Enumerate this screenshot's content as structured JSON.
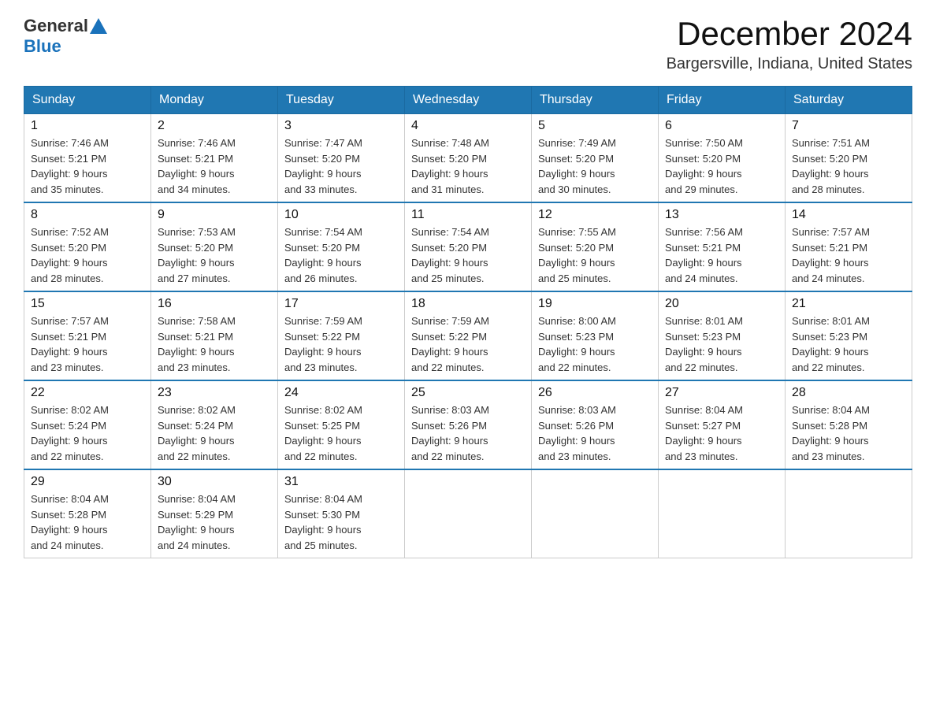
{
  "header": {
    "logo_general": "General",
    "logo_blue": "Blue",
    "month_title": "December 2024",
    "location": "Bargersville, Indiana, United States"
  },
  "weekdays": [
    "Sunday",
    "Monday",
    "Tuesday",
    "Wednesday",
    "Thursday",
    "Friday",
    "Saturday"
  ],
  "weeks": [
    [
      {
        "day": "1",
        "sunrise": "7:46 AM",
        "sunset": "5:21 PM",
        "daylight": "9 hours and 35 minutes."
      },
      {
        "day": "2",
        "sunrise": "7:46 AM",
        "sunset": "5:21 PM",
        "daylight": "9 hours and 34 minutes."
      },
      {
        "day": "3",
        "sunrise": "7:47 AM",
        "sunset": "5:20 PM",
        "daylight": "9 hours and 33 minutes."
      },
      {
        "day": "4",
        "sunrise": "7:48 AM",
        "sunset": "5:20 PM",
        "daylight": "9 hours and 31 minutes."
      },
      {
        "day": "5",
        "sunrise": "7:49 AM",
        "sunset": "5:20 PM",
        "daylight": "9 hours and 30 minutes."
      },
      {
        "day": "6",
        "sunrise": "7:50 AM",
        "sunset": "5:20 PM",
        "daylight": "9 hours and 29 minutes."
      },
      {
        "day": "7",
        "sunrise": "7:51 AM",
        "sunset": "5:20 PM",
        "daylight": "9 hours and 28 minutes."
      }
    ],
    [
      {
        "day": "8",
        "sunrise": "7:52 AM",
        "sunset": "5:20 PM",
        "daylight": "9 hours and 28 minutes."
      },
      {
        "day": "9",
        "sunrise": "7:53 AM",
        "sunset": "5:20 PM",
        "daylight": "9 hours and 27 minutes."
      },
      {
        "day": "10",
        "sunrise": "7:54 AM",
        "sunset": "5:20 PM",
        "daylight": "9 hours and 26 minutes."
      },
      {
        "day": "11",
        "sunrise": "7:54 AM",
        "sunset": "5:20 PM",
        "daylight": "9 hours and 25 minutes."
      },
      {
        "day": "12",
        "sunrise": "7:55 AM",
        "sunset": "5:20 PM",
        "daylight": "9 hours and 25 minutes."
      },
      {
        "day": "13",
        "sunrise": "7:56 AM",
        "sunset": "5:21 PM",
        "daylight": "9 hours and 24 minutes."
      },
      {
        "day": "14",
        "sunrise": "7:57 AM",
        "sunset": "5:21 PM",
        "daylight": "9 hours and 24 minutes."
      }
    ],
    [
      {
        "day": "15",
        "sunrise": "7:57 AM",
        "sunset": "5:21 PM",
        "daylight": "9 hours and 23 minutes."
      },
      {
        "day": "16",
        "sunrise": "7:58 AM",
        "sunset": "5:21 PM",
        "daylight": "9 hours and 23 minutes."
      },
      {
        "day": "17",
        "sunrise": "7:59 AM",
        "sunset": "5:22 PM",
        "daylight": "9 hours and 23 minutes."
      },
      {
        "day": "18",
        "sunrise": "7:59 AM",
        "sunset": "5:22 PM",
        "daylight": "9 hours and 22 minutes."
      },
      {
        "day": "19",
        "sunrise": "8:00 AM",
        "sunset": "5:23 PM",
        "daylight": "9 hours and 22 minutes."
      },
      {
        "day": "20",
        "sunrise": "8:01 AM",
        "sunset": "5:23 PM",
        "daylight": "9 hours and 22 minutes."
      },
      {
        "day": "21",
        "sunrise": "8:01 AM",
        "sunset": "5:23 PM",
        "daylight": "9 hours and 22 minutes."
      }
    ],
    [
      {
        "day": "22",
        "sunrise": "8:02 AM",
        "sunset": "5:24 PM",
        "daylight": "9 hours and 22 minutes."
      },
      {
        "day": "23",
        "sunrise": "8:02 AM",
        "sunset": "5:24 PM",
        "daylight": "9 hours and 22 minutes."
      },
      {
        "day": "24",
        "sunrise": "8:02 AM",
        "sunset": "5:25 PM",
        "daylight": "9 hours and 22 minutes."
      },
      {
        "day": "25",
        "sunrise": "8:03 AM",
        "sunset": "5:26 PM",
        "daylight": "9 hours and 22 minutes."
      },
      {
        "day": "26",
        "sunrise": "8:03 AM",
        "sunset": "5:26 PM",
        "daylight": "9 hours and 23 minutes."
      },
      {
        "day": "27",
        "sunrise": "8:04 AM",
        "sunset": "5:27 PM",
        "daylight": "9 hours and 23 minutes."
      },
      {
        "day": "28",
        "sunrise": "8:04 AM",
        "sunset": "5:28 PM",
        "daylight": "9 hours and 23 minutes."
      }
    ],
    [
      {
        "day": "29",
        "sunrise": "8:04 AM",
        "sunset": "5:28 PM",
        "daylight": "9 hours and 24 minutes."
      },
      {
        "day": "30",
        "sunrise": "8:04 AM",
        "sunset": "5:29 PM",
        "daylight": "9 hours and 24 minutes."
      },
      {
        "day": "31",
        "sunrise": "8:04 AM",
        "sunset": "5:30 PM",
        "daylight": "9 hours and 25 minutes."
      },
      null,
      null,
      null,
      null
    ]
  ]
}
